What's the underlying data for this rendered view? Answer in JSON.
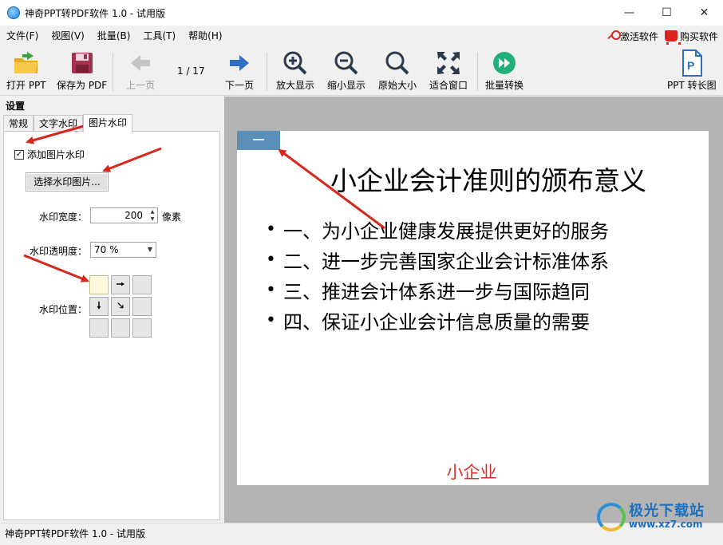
{
  "window": {
    "title": "神奇PPT转PDF软件 1.0 - 试用版",
    "min_glyph": "—",
    "max_glyph": "☐",
    "close_glyph": "✕"
  },
  "menubar": {
    "items": [
      "文件(F)",
      "视图(V)",
      "批量(B)",
      "工具(T)",
      "帮助(H)"
    ],
    "activate": "激活软件",
    "buy": "购买软件"
  },
  "toolbar": {
    "open": "打开 PPT",
    "save_as_pdf": "保存为 PDF",
    "prev_page": "上一页",
    "page_indicator": "1 / 17",
    "next_page": "下一页",
    "zoom_in": "放大显示",
    "zoom_out": "缩小显示",
    "original_size": "原始大小",
    "fit_window": "适合窗口",
    "batch_convert": "批量转换",
    "ppt_to_long_image": "PPT 转长图"
  },
  "panel": {
    "header": "设置",
    "tabs": [
      "常规",
      "文字水印",
      "图片水印"
    ],
    "active_tab": 2,
    "add_image_watermark": {
      "label": "添加图片水印",
      "checked": true
    },
    "select_image_button": "选择水印图片...",
    "width_label": "水印宽度：",
    "width_value": "200",
    "width_unit": "像素",
    "opacity_label": "水印透明度：",
    "opacity_value": "70 %",
    "position_label": "水印位置：",
    "position_cells": [
      "",
      "🠖",
      "",
      "🠗",
      "🡖",
      "",
      "",
      "",
      ""
    ],
    "selected_position": 0
  },
  "slide": {
    "title": "小企业会计准则的颁布意义",
    "bullet_char": "•",
    "bullets": [
      "一、为小企业健康发展提供更好的服务",
      "二、进一步完善国家企业会计标准体系",
      "三、推进会计体系进一步与国际趋同",
      "四、保证小企业会计信息质量的需要"
    ],
    "footer": "小企业",
    "footer_color": "#e0302a"
  },
  "statusbar": {
    "text": "神奇PPT转PDF软件 1.0 - 试用版"
  },
  "site_watermark": {
    "name": "极光下载站",
    "url": "www.xz7.com"
  },
  "colors": {
    "annotation_arrow": "#d8261c",
    "accent_blue": "#2f6fc2"
  }
}
